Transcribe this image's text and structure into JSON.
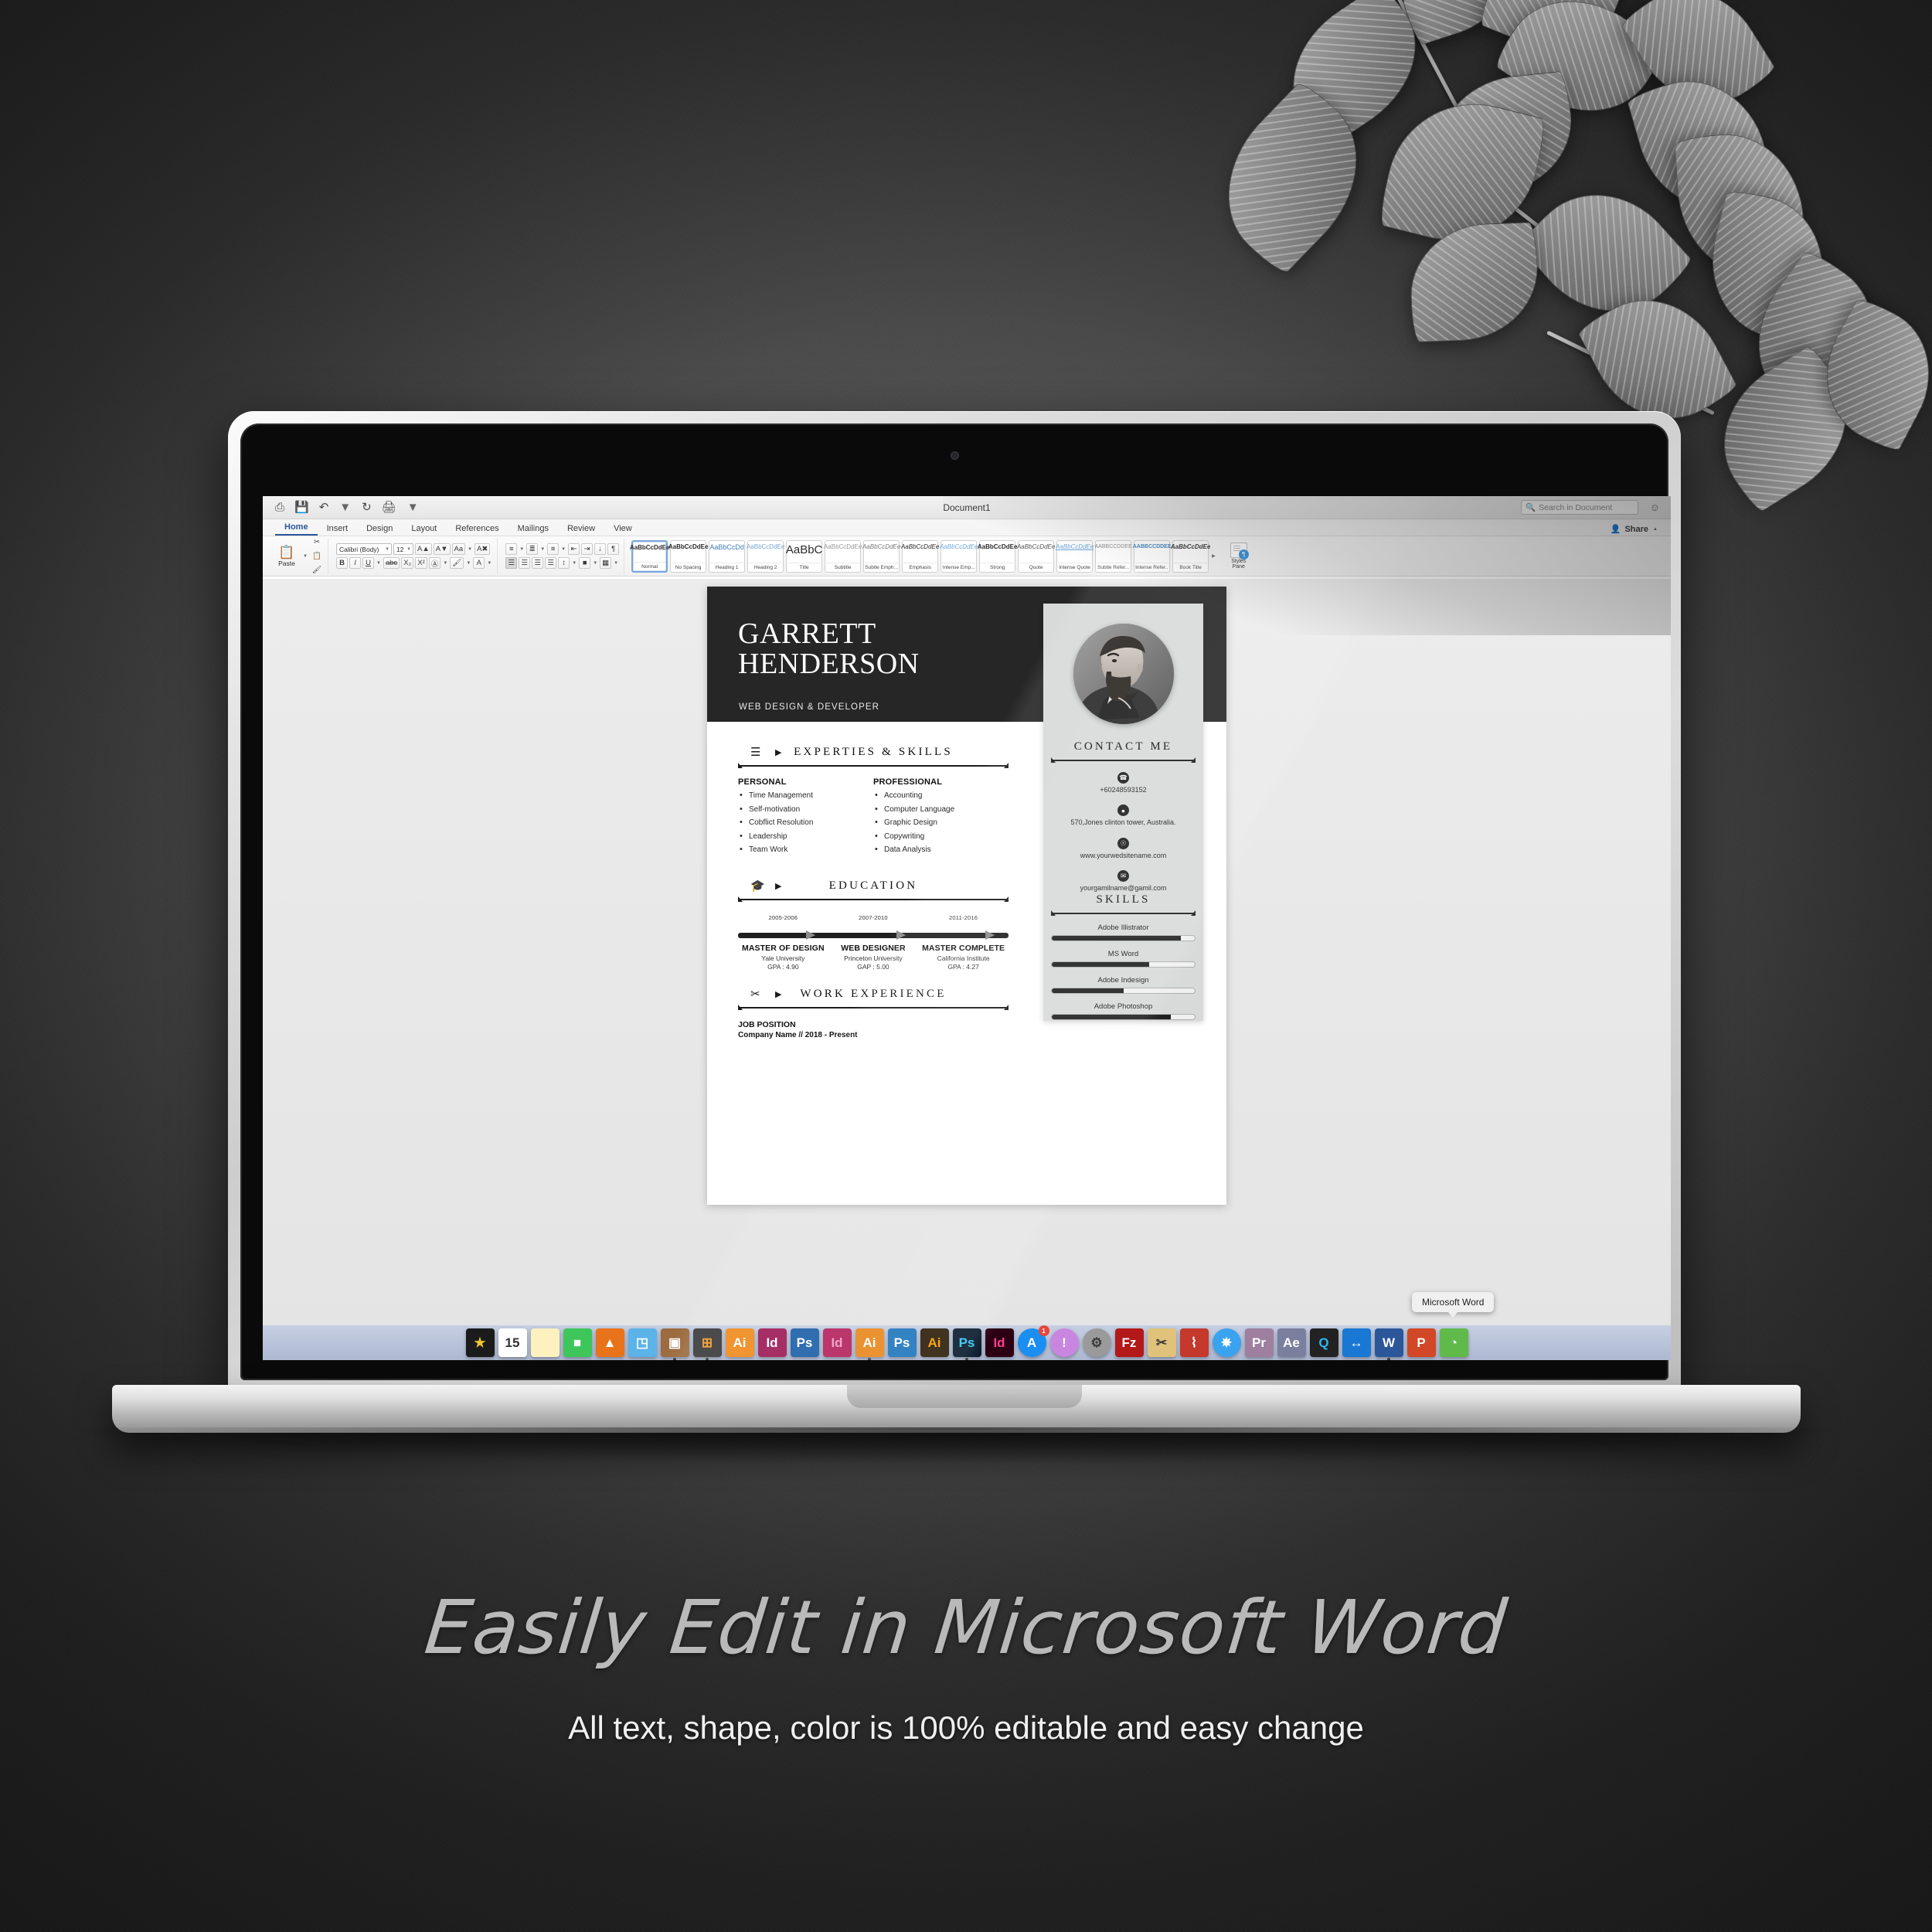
{
  "app": {
    "title": "Document1",
    "quick_access": [
      "print-layout-icon",
      "save-icon",
      "undo-icon",
      "redo-icon",
      "print-icon",
      "customize-icon"
    ],
    "search_placeholder": "Search in Document",
    "share_label": "Share",
    "tabs": [
      {
        "label": "Home",
        "active": true
      },
      {
        "label": "Insert",
        "active": false
      },
      {
        "label": "Design",
        "active": false
      },
      {
        "label": "Layout",
        "active": false
      },
      {
        "label": "References",
        "active": false
      },
      {
        "label": "Mailings",
        "active": false
      },
      {
        "label": "Review",
        "active": false
      },
      {
        "label": "View",
        "active": false
      }
    ],
    "ribbon": {
      "paste_label": "Paste",
      "font_name": "Calibri (Body)",
      "font_size": "12",
      "styles_pane_label": "Styles\nPane",
      "styles_pane_line1": "Styles",
      "styles_pane_line2": "Pane",
      "styles": [
        {
          "preview": "AaBbCcDdEe",
          "name": "Normal",
          "selected": true
        },
        {
          "preview": "AaBbCcDdEe",
          "name": "No Spacing",
          "selected": false
        },
        {
          "preview": "AaBbCcDd",
          "name": "Heading 1",
          "selected": false
        },
        {
          "preview": "AaBbCcDdEe",
          "name": "Heading 2",
          "selected": false
        },
        {
          "preview": "AaBbC",
          "name": "Title",
          "selected": false
        },
        {
          "preview": "AaBbCcDdEe",
          "name": "Subtitle",
          "selected": false
        },
        {
          "preview": "AaBbCcDdEe",
          "name": "Subtle Emph...",
          "selected": false
        },
        {
          "preview": "AaBbCcDdEe",
          "name": "Emphasis",
          "selected": false
        },
        {
          "preview": "AaBbCcDdEe",
          "name": "Intense Emp...",
          "selected": false
        },
        {
          "preview": "AaBbCcDdEe",
          "name": "Strong",
          "selected": false
        },
        {
          "preview": "AaBbCcDdEe",
          "name": "Quote",
          "selected": false
        },
        {
          "preview": "AaBbCcDdEe",
          "name": "Intense Quote",
          "selected": false
        },
        {
          "preview": "AABBCCDDEE",
          "name": "Subtle Refer...",
          "selected": false
        },
        {
          "preview": "AABBCCDDEE",
          "name": "Intense Refer...",
          "selected": false
        },
        {
          "preview": "AaBbCcDdEe",
          "name": "Book Title",
          "selected": false
        }
      ]
    }
  },
  "resume": {
    "name_line1": "GARRETT",
    "name_line2": "HENDERSON",
    "role": "WEB DESIGN & DEVELOPER",
    "sections": {
      "expertise": {
        "icon": "layers-icon",
        "title": "EXPERTIES & SKILLS",
        "left_heading": "PERSONAL",
        "left_items": [
          "Time Management",
          "Self-motivation",
          "Cobflict Resolution",
          "Leadership",
          "Team Work"
        ],
        "right_heading": "PROFESSIONAL",
        "right_items": [
          "Accounting",
          "Computer Language",
          "Graphic Design",
          "Copywriting",
          "Data Analysis"
        ]
      },
      "education": {
        "icon": "graduation-cap-icon",
        "title": "EDUCATION",
        "entries": [
          {
            "years": "2005-2006",
            "degree": "MASTER OF DESIGN",
            "school": "Yale University",
            "gpa": "GPA : 4.90"
          },
          {
            "years": "2007-2010",
            "degree": "WEB DESIGNER",
            "school": "Princeton University",
            "gpa": "GAP : 5.00"
          },
          {
            "years": "2011-2016",
            "degree": "MASTER COMPLETE",
            "school": "California Institute",
            "gpa": "GPA : 4.27"
          }
        ]
      },
      "work": {
        "icon": "tools-icon",
        "title": "WORK EXPERIENCE",
        "position": "JOB POSITION",
        "company": "Company Name  //  2018 - Present"
      },
      "contact": {
        "title": "CONTACT ME",
        "items": [
          {
            "icon": "phone-icon",
            "glyph": "✆",
            "text": "+60248593152"
          },
          {
            "icon": "location-pin-icon",
            "glyph": "◉",
            "text": "570,Jones clinton tower, Australia."
          },
          {
            "icon": "globe-icon",
            "glyph": "Ⓘ",
            "text": "www.yourwedsitename.com"
          },
          {
            "icon": "envelope-icon",
            "glyph": "✉",
            "text": "yourgamilname@gamil.com"
          }
        ]
      },
      "skills": {
        "title": "SKILLS",
        "items": [
          {
            "label": "Adobe Illistrator",
            "percent": 90
          },
          {
            "label": "MS Word",
            "percent": 68
          },
          {
            "label": "Adobe Indesign",
            "percent": 50
          },
          {
            "label": "Adobe Photoshop",
            "percent": 83
          }
        ]
      }
    }
  },
  "dock": {
    "tooltip": "Microsoft Word",
    "items": [
      {
        "name": "imovie-icon",
        "glyph": "★",
        "bg": "#1b1b1b",
        "color": "#f0c330",
        "dot": false,
        "badge": null
      },
      {
        "name": "calendar-icon",
        "glyph": "15",
        "bg": "#ffffff",
        "color": "#333333",
        "dot": false,
        "badge": null
      },
      {
        "name": "notes-icon",
        "glyph": "",
        "bg": "#fdf1c0",
        "color": "#8a7a3a",
        "dot": false,
        "badge": null
      },
      {
        "name": "facetime-icon",
        "glyph": "■",
        "bg": "#3ec65a",
        "color": "#ffffff",
        "dot": false,
        "badge": null
      },
      {
        "name": "vlc-icon",
        "glyph": "▲",
        "bg": "#e8731a",
        "color": "#ffffff",
        "dot": false,
        "badge": null
      },
      {
        "name": "keynote-icon",
        "glyph": "◳",
        "bg": "#5cb3e8",
        "color": "#ffffff",
        "dot": false,
        "badge": null
      },
      {
        "name": "apple-remote-desktop-icon",
        "glyph": "▣",
        "bg": "#9c6b3f",
        "color": "#ffffff",
        "dot": true,
        "badge": null
      },
      {
        "name": "calculator-icon",
        "glyph": "⊞",
        "bg": "#3a3a3a",
        "color": "#f29b2a",
        "dot": true,
        "badge": null
      },
      {
        "name": "illustrator-icon",
        "glyph": "Ai",
        "bg": "#f08a1e",
        "color": "#ffffff",
        "dot": false,
        "badge": null
      },
      {
        "name": "indesign-icon",
        "glyph": "Id",
        "bg": "#9c1a55",
        "color": "#ffffff",
        "dot": false,
        "badge": null
      },
      {
        "name": "photoshop-icon",
        "glyph": "Ps",
        "bg": "#1b5fa8",
        "color": "#ffffff",
        "dot": false,
        "badge": null
      },
      {
        "name": "indesign-cc-icon",
        "glyph": "Id",
        "bg": "#b4215c",
        "color": "#f09ec0",
        "dot": false,
        "badge": null
      },
      {
        "name": "illustrator-cc-icon",
        "glyph": "Ai",
        "bg": "#e8871c",
        "color": "#ffffff",
        "dot": true,
        "badge": null
      },
      {
        "name": "photoshop-cc-icon",
        "glyph": "Ps",
        "bg": "#1d74bb",
        "color": "#ffffff",
        "dot": false,
        "badge": null
      },
      {
        "name": "illustrator-dark-icon",
        "glyph": "Ai",
        "bg": "#2b1c06",
        "color": "#ff9a00",
        "dot": false,
        "badge": null
      },
      {
        "name": "photoshop-dark-icon",
        "glyph": "Ps",
        "bg": "#06182b",
        "color": "#31c5f0",
        "dot": true,
        "badge": null
      },
      {
        "name": "indesign-dark-icon",
        "glyph": "Id",
        "bg": "#2b0013",
        "color": "#ff3f8e",
        "dot": false,
        "badge": null
      },
      {
        "name": "app-store-icon",
        "glyph": "A",
        "bg": "#1b8ef2",
        "color": "#ffffff",
        "dot": false,
        "badge": "1"
      },
      {
        "name": "console-icon",
        "glyph": "!",
        "bg": "#c986e0",
        "color": "#ffffff",
        "dot": false,
        "badge": null
      },
      {
        "name": "system-preferences-icon",
        "glyph": "⚙",
        "bg": "#9a9a9a",
        "color": "#3a3a3a",
        "dot": false,
        "badge": null
      },
      {
        "name": "filezilla-icon",
        "glyph": "Fz",
        "bg": "#b31919",
        "color": "#ffffff",
        "dot": false,
        "badge": null
      },
      {
        "name": "unarchiver-icon",
        "glyph": "✂",
        "bg": "#e0c27a",
        "color": "#3a3a3a",
        "dot": false,
        "badge": null
      },
      {
        "name": "folx-icon",
        "glyph": "⌇",
        "bg": "#c4392b",
        "color": "#ffffff",
        "dot": false,
        "badge": null
      },
      {
        "name": "shareit-icon",
        "glyph": "✵",
        "bg": "#3aa3f0",
        "color": "#ffffff",
        "dot": false,
        "badge": null
      },
      {
        "name": "premiere-icon",
        "glyph": "Pr",
        "bg": "#9f7f9f",
        "color": "#ffffff",
        "dot": false,
        "badge": null
      },
      {
        "name": "after-effects-icon",
        "glyph": "Ae",
        "bg": "#7b7f9e",
        "color": "#ffffff",
        "dot": false,
        "badge": null
      },
      {
        "name": "quicktime-icon",
        "glyph": "Q",
        "bg": "#222222",
        "color": "#2bb8f0",
        "dot": false,
        "badge": null
      },
      {
        "name": "teamviewer-icon",
        "glyph": "↔",
        "bg": "#1878d4",
        "color": "#ffffff",
        "dot": false,
        "badge": null
      },
      {
        "name": "microsoft-word-icon",
        "glyph": "W",
        "bg": "#2b579a",
        "color": "#ffffff",
        "dot": true,
        "badge": null
      },
      {
        "name": "microsoft-powerpoint-icon",
        "glyph": "P",
        "bg": "#d24726",
        "color": "#ffffff",
        "dot": false,
        "badge": null
      },
      {
        "name": "sketchup-icon",
        "glyph": "◔",
        "bg": "#5fba4a",
        "color": "#ffffff",
        "dot": false,
        "badge": null
      }
    ]
  },
  "captions": {
    "headline": "Easily Edit in Microsoft Word",
    "subline": "All text, shape, color is 100% editable and easy change"
  }
}
